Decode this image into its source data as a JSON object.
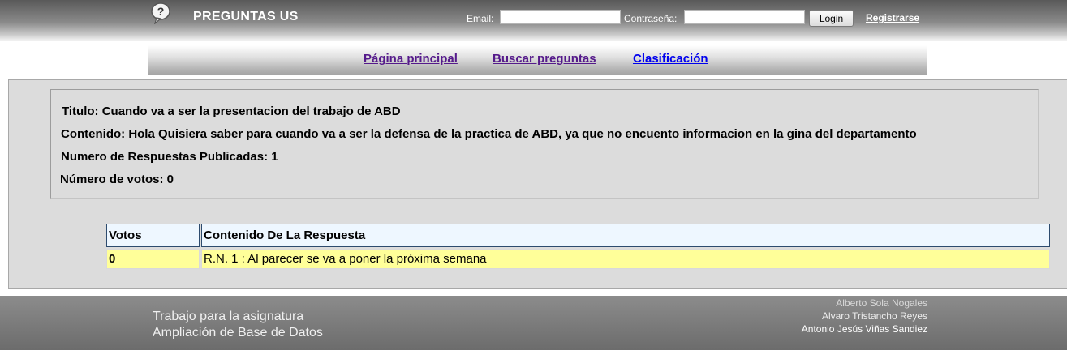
{
  "header": {
    "site_title": "PREGUNTAS US",
    "email_label": "Email:",
    "email_value": "",
    "password_label": "Contraseña:",
    "password_value": "",
    "login_label": "Login",
    "register_label": "Registrarse"
  },
  "nav": {
    "items": [
      {
        "label": "Página principal"
      },
      {
        "label": "Buscar preguntas"
      },
      {
        "label": "Clasificación"
      }
    ]
  },
  "question": {
    "title_line": "Titulo: Cuando va a ser la presentacion del trabajo de ABD",
    "content_line": "Contenido: Hola Quisiera saber para cuando va a ser la defensa de la practica de ABD, ya que no encuento informacion en la gina del departamento",
    "answers_count_line": "Numero de Respuestas Publicadas: 1",
    "votes_line": "Número de votos: 0"
  },
  "answers": {
    "columns": [
      "Votos",
      "Contenido De La Respuesta"
    ],
    "rows": [
      {
        "votes": "0",
        "content": "R.N. 1 : Al parecer se va a poner la próxima semana"
      }
    ]
  },
  "footer": {
    "line1": "Trabajo para la asignatura",
    "line2": "Ampliación de Base de Datos",
    "authors": [
      "Alberto Sola Nogales",
      "Alvaro Tristancho Reyes",
      "Antonio Jesús Viñas Sandiez"
    ]
  },
  "colors": {
    "answer_row_bg": "#ffff99",
    "table_header_bg": "#eef7ff",
    "main_bg": "#dcdcdc",
    "visited_link": "#551a8b",
    "link": "#0000ee"
  }
}
